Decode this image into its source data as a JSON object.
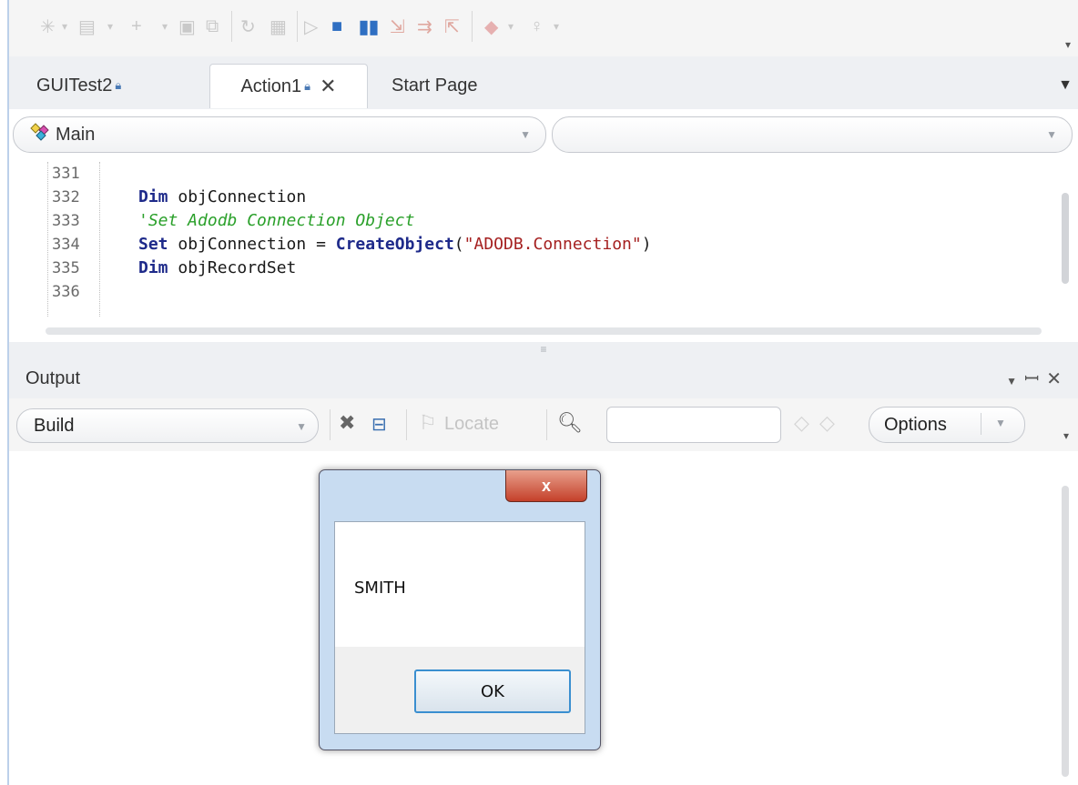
{
  "tabs": [
    {
      "label": "GUITest2",
      "locked": true
    },
    {
      "label": "Action1",
      "locked": true,
      "close": "✕"
    },
    {
      "label": "Start Page"
    }
  ],
  "editor": {
    "function_combo": "Main",
    "lines": [
      {
        "num": "331",
        "text": ""
      },
      {
        "num": "332",
        "text": "Dim objConnection"
      },
      {
        "num": "333",
        "text": "'Set Adodb Connection Object"
      },
      {
        "num": "334",
        "text": "Set objConnection = CreateObject(\"ADODB.Connection\")"
      },
      {
        "num": "335",
        "text": "Dim objRecordSet"
      },
      {
        "num": "336",
        "text": ""
      }
    ]
  },
  "output": {
    "title": "Output",
    "source_combo": "Build",
    "locate_label": "Locate",
    "options_label": "Options"
  },
  "msgbox": {
    "message": "SMITH",
    "ok_label": "OK",
    "close_glyph": "x"
  },
  "colors": {
    "keyword": "#1e2a8a",
    "comment": "#2aa02a",
    "string": "#a52020"
  }
}
